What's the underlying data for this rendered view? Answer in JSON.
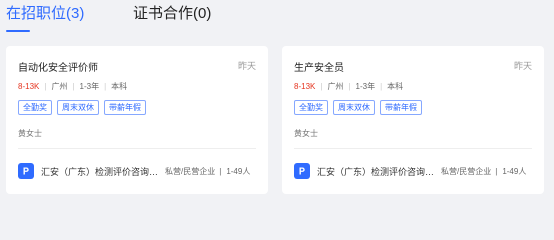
{
  "tabs": [
    {
      "label": "在招职位(3)"
    },
    {
      "label": "证书合作(0)"
    }
  ],
  "jobs": [
    {
      "title": "自动化安全评价师",
      "posted": "昨天",
      "salary": "8-13K",
      "city": "广州",
      "experience": "1-3年",
      "education": "本科",
      "tags": [
        "全勤奖",
        "周末双休",
        "带薪年假"
      ],
      "contact": "黄女士",
      "company": "汇安（广东）检测评价咨询有限公司",
      "company_type": "私营/民营企业",
      "company_size": "1-49人"
    },
    {
      "title": "生产安全员",
      "posted": "昨天",
      "salary": "8-13K",
      "city": "广州",
      "experience": "1-3年",
      "education": "本科",
      "tags": [
        "全勤奖",
        "周末双休",
        "带薪年假"
      ],
      "contact": "黄女士",
      "company": "汇安（广东）检测评价咨询有限公司",
      "company_type": "私营/民营企业",
      "company_size": "1-49人"
    }
  ],
  "colors": {
    "accent": "#2f6bff",
    "salary": "#e5341f",
    "background": "#f1f2f5"
  },
  "icons": {
    "company_logo": "letter-p-logo-icon"
  }
}
